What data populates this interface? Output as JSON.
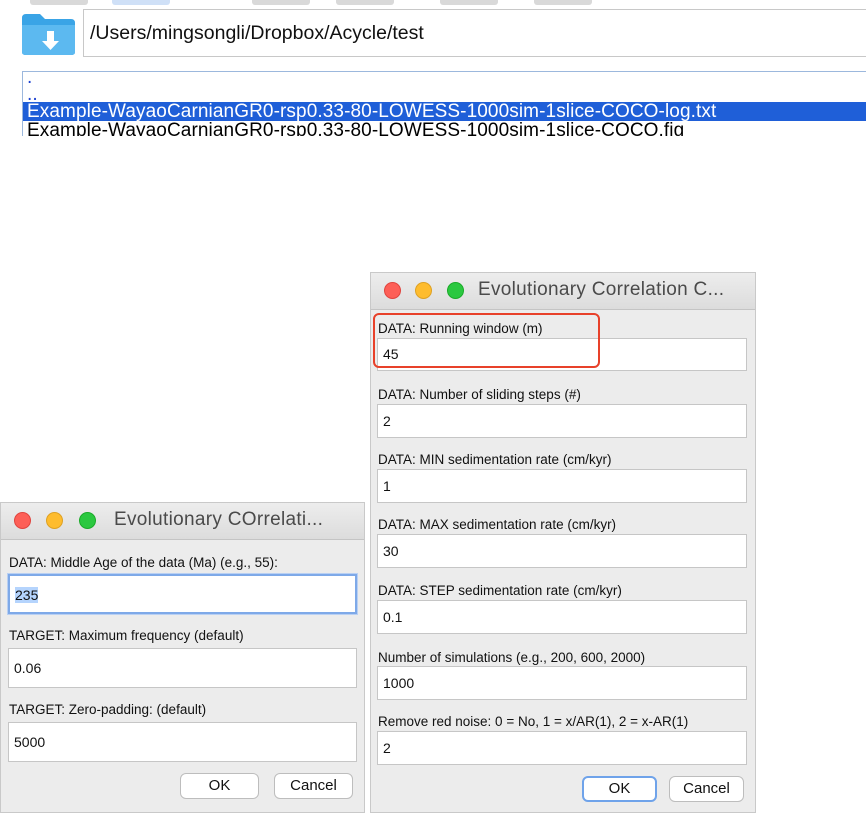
{
  "file_browser": {
    "path": "/Users/mingsongli/Dropbox/Acycle/test",
    "items": [
      ".",
      "..",
      "Example-WayaoCarnianGR0-rsp0.33-80-LOWESS-1000sim-1slice-COCO-log.txt",
      "Example-WayaoCarnianGR0-rsp0.33-80-LOWESS-1000sim-1slice-COCO.fig"
    ],
    "selected_index": 2
  },
  "dialog_left": {
    "title": "Evolutionary COrrelati...",
    "fields": [
      {
        "label": "DATA: Middle Age of the data (Ma) (e.g., 55):",
        "value": "235"
      },
      {
        "label": "TARGET: Maximum frequency (default)",
        "value": "0.06"
      },
      {
        "label": "TARGET: Zero-padding: (default)",
        "value": "5000"
      }
    ],
    "ok_label": "OK",
    "cancel_label": "Cancel"
  },
  "dialog_right": {
    "title": "Evolutionary Correlation C...",
    "fields": [
      {
        "label": "DATA: Running window (m)",
        "value": "45"
      },
      {
        "label": "DATA: Number of sliding steps (#)",
        "value": "2"
      },
      {
        "label": "DATA: MIN  sedimentation rate (cm/kyr)",
        "value": "1"
      },
      {
        "label": "DATA: MAX  sedimentation rate (cm/kyr)",
        "value": "30"
      },
      {
        "label": "DATA: STEP sedimentation rate (cm/kyr)",
        "value": "0.1"
      },
      {
        "label": "Number of simulations (e.g., 200, 600, 2000)",
        "value": "1000"
      },
      {
        "label": "Remove red noise: 0 = No, 1 = x/AR(1), 2 = x-AR(1)",
        "value": "2"
      }
    ],
    "ok_label": "OK",
    "cancel_label": "Cancel"
  },
  "colors": {
    "selection": "#1f5fd8",
    "link_text": "#1a3fd0",
    "annotation_box": "#e8412a",
    "focus_ring": "#7ea9e8"
  }
}
